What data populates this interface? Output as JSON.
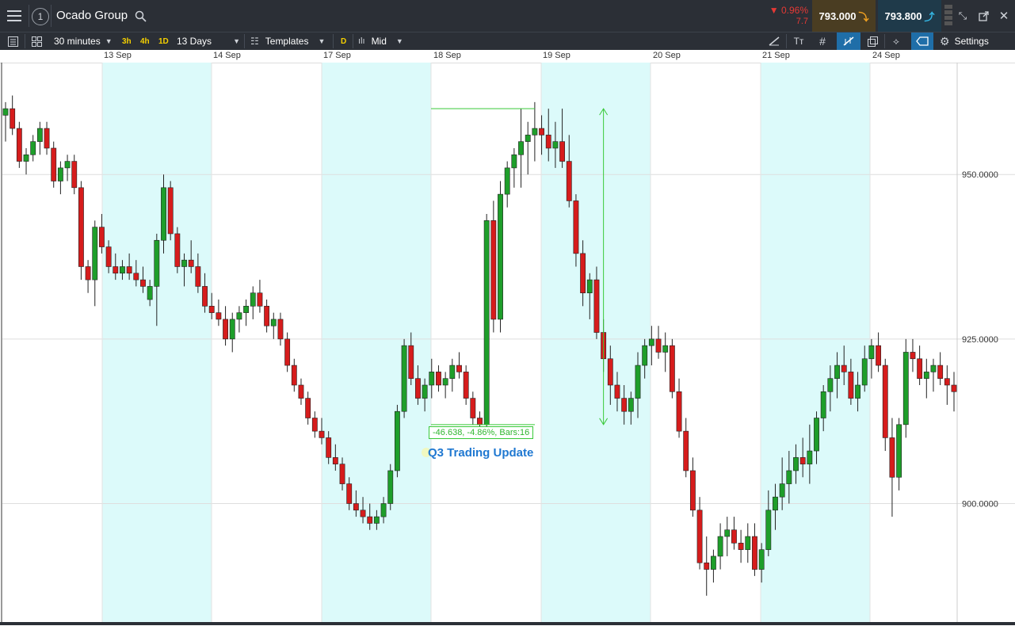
{
  "header": {
    "instrument": "Ocado Group",
    "menu_icon": "hamburger-menu-icon",
    "layout_badge": "1",
    "change_pct": "▼ 0.96%",
    "change_abs": "7.7",
    "sell_price": "793.000",
    "buy_price": "793.800",
    "colors": {
      "sell_bg": "#4a3d22",
      "buy_bg": "#1f3a4a",
      "down": "#e53935"
    }
  },
  "toolbar": {
    "interval": "30 minutes",
    "quick_intervals": [
      "3h",
      "4h",
      "1D"
    ],
    "range": "13 Days",
    "templates": "Templates",
    "price_type_badge": "D",
    "price_type": "Mid",
    "settings": "Settings"
  },
  "date_axis": [
    "13 Sep",
    "14 Sep",
    "17 Sep",
    "18 Sep",
    "19 Sep",
    "20 Sep",
    "21 Sep",
    "24 Sep"
  ],
  "annotation": {
    "measure_label": "-46.638, -4.86%, Bars:16",
    "event_label": "Q3 Trading Update"
  },
  "chart_data": {
    "type": "candlestick",
    "interval": "30 minutes",
    "ylabel_ticks": [
      "950.0000",
      "925.0000",
      "900.0000"
    ],
    "ylim": [
      882,
      967
    ],
    "grid": true,
    "colors": {
      "up": "#1e9e2a",
      "down": "#d61c1c",
      "shade": "#dcfafa",
      "measure": "#39c939"
    },
    "sessions": [
      {
        "label": "13 Sep",
        "shaded": false
      },
      {
        "label": "14 Sep",
        "shaded": true
      },
      {
        "label": "17 Sep",
        "shaded": false
      },
      {
        "label": "18 Sep",
        "shaded": true
      },
      {
        "label": "19 Sep",
        "shaded": false
      },
      {
        "label": "20 Sep",
        "shaded": true
      },
      {
        "label": "21 Sep",
        "shaded": false
      },
      {
        "label": "24 Sep",
        "shaded": true
      },
      {
        "label": "",
        "shaded": false
      }
    ],
    "candles": [
      [
        959,
        961,
        955,
        960
      ],
      [
        960,
        962,
        956,
        957
      ],
      [
        957,
        958,
        951,
        952
      ],
      [
        952,
        954,
        950,
        953
      ],
      [
        953,
        956,
        952,
        955
      ],
      [
        955,
        958,
        953,
        957
      ],
      [
        957,
        958,
        953,
        954
      ],
      [
        954,
        955,
        948,
        949
      ],
      [
        949,
        952,
        947,
        951
      ],
      [
        951,
        953,
        949,
        952
      ],
      [
        952,
        953,
        947,
        948
      ],
      [
        948,
        949,
        934,
        936
      ],
      [
        936,
        937,
        932,
        934
      ],
      [
        934,
        943,
        930,
        942
      ],
      [
        942,
        944,
        938,
        939
      ],
      [
        939,
        940,
        935,
        936
      ],
      [
        936,
        938,
        934,
        935
      ],
      [
        935,
        937,
        934,
        936
      ],
      [
        936,
        938,
        934,
        935
      ],
      [
        935,
        937,
        933,
        934
      ],
      [
        934,
        936,
        932,
        933
      ],
      [
        931,
        934,
        930,
        933
      ],
      [
        933,
        941,
        927,
        940
      ],
      [
        940,
        950,
        938,
        948
      ],
      [
        948,
        949,
        940,
        941
      ],
      [
        941,
        942,
        935,
        936
      ],
      [
        936,
        938,
        933,
        937
      ],
      [
        937,
        940,
        935,
        936
      ],
      [
        936,
        938,
        932,
        933
      ],
      [
        933,
        935,
        929,
        930
      ],
      [
        930,
        932,
        928,
        929
      ],
      [
        929,
        931,
        927,
        928
      ],
      [
        928,
        930,
        924,
        925
      ],
      [
        925,
        929,
        923,
        928
      ],
      [
        928,
        930,
        926,
        929
      ],
      [
        929,
        931,
        927,
        930
      ],
      [
        930,
        933,
        928,
        932
      ],
      [
        932,
        934,
        929,
        930
      ],
      [
        930,
        931,
        926,
        927
      ],
      [
        927,
        929,
        925,
        928
      ],
      [
        928,
        929,
        924,
        925
      ],
      [
        925,
        926,
        920,
        921
      ],
      [
        921,
        922,
        917,
        918
      ],
      [
        918,
        919,
        915,
        916
      ],
      [
        916,
        917,
        912,
        913
      ],
      [
        913,
        914,
        910,
        911
      ],
      [
        911,
        913,
        909,
        910
      ],
      [
        910,
        911,
        906,
        907
      ],
      [
        907,
        909,
        905,
        906
      ],
      [
        906,
        907,
        902,
        903
      ],
      [
        903,
        904,
        899,
        900
      ],
      [
        900,
        902,
        898,
        899
      ],
      [
        899,
        901,
        897,
        898
      ],
      [
        898,
        900,
        896,
        897
      ],
      [
        897,
        899,
        896,
        898
      ],
      [
        898,
        901,
        897,
        900
      ],
      [
        900,
        906,
        899,
        905
      ],
      [
        905,
        915,
        904,
        914
      ],
      [
        914,
        925,
        913,
        924
      ],
      [
        924,
        926,
        918,
        919
      ],
      [
        919,
        921,
        915,
        916
      ],
      [
        916,
        919,
        914,
        918
      ],
      [
        918,
        922,
        916,
        920
      ],
      [
        920,
        921,
        917,
        918
      ],
      [
        918,
        920,
        916,
        919
      ],
      [
        919,
        922,
        917,
        921
      ],
      [
        921,
        923,
        919,
        920
      ],
      [
        920,
        921,
        915,
        916
      ],
      [
        916,
        917,
        912,
        913
      ],
      [
        913,
        914,
        911,
        912
      ],
      [
        912,
        944,
        911,
        943
      ],
      [
        943,
        946,
        926,
        928
      ],
      [
        928,
        949,
        926,
        947
      ],
      [
        947,
        952,
        945,
        951
      ],
      [
        951,
        954,
        948,
        953
      ],
      [
        953,
        960,
        948,
        955
      ],
      [
        955,
        958,
        950,
        956
      ],
      [
        956,
        961,
        952,
        957
      ],
      [
        957,
        959,
        953,
        956
      ],
      [
        956,
        960,
        952,
        954
      ],
      [
        954,
        958,
        951,
        955
      ],
      [
        955,
        960,
        951,
        952
      ],
      [
        952,
        956,
        945,
        946
      ],
      [
        946,
        947,
        936,
        938
      ],
      [
        938,
        940,
        930,
        932
      ],
      [
        932,
        935,
        928,
        934
      ],
      [
        934,
        936,
        925,
        926
      ],
      [
        926,
        928,
        920,
        922
      ],
      [
        922,
        924,
        915,
        918
      ],
      [
        918,
        920,
        914,
        916
      ],
      [
        916,
        918,
        912,
        914
      ],
      [
        914,
        917,
        912,
        916
      ],
      [
        916,
        923,
        913,
        921
      ],
      [
        921,
        925,
        919,
        924
      ],
      [
        924,
        927,
        921,
        925
      ],
      [
        925,
        927,
        922,
        923
      ],
      [
        923,
        926,
        920,
        924
      ],
      [
        924,
        925,
        916,
        917
      ],
      [
        917,
        919,
        910,
        911
      ],
      [
        911,
        913,
        904,
        905
      ],
      [
        905,
        907,
        898,
        899
      ],
      [
        899,
        901,
        890,
        891
      ],
      [
        891,
        895,
        886,
        890
      ],
      [
        890,
        893,
        888,
        892
      ],
      [
        892,
        897,
        890,
        895
      ],
      [
        895,
        898,
        892,
        896
      ],
      [
        896,
        898,
        893,
        894
      ],
      [
        894,
        896,
        891,
        893
      ],
      [
        893,
        897,
        891,
        895
      ],
      [
        895,
        897,
        889,
        890
      ],
      [
        890,
        894,
        888,
        893
      ],
      [
        893,
        902,
        892,
        899
      ],
      [
        899,
        903,
        896,
        901
      ],
      [
        901,
        907,
        899,
        903
      ],
      [
        903,
        908,
        900,
        905
      ],
      [
        905,
        909,
        903,
        907
      ],
      [
        907,
        910,
        904,
        906
      ],
      [
        906,
        912,
        903,
        908
      ],
      [
        908,
        914,
        906,
        913
      ],
      [
        913,
        918,
        911,
        917
      ],
      [
        917,
        921,
        914,
        919
      ],
      [
        919,
        923,
        916,
        921
      ],
      [
        921,
        924,
        918,
        920
      ],
      [
        920,
        922,
        915,
        916
      ],
      [
        916,
        920,
        914,
        918
      ],
      [
        918,
        924,
        917,
        922
      ],
      [
        922,
        925,
        919,
        924
      ],
      [
        924,
        926,
        920,
        921
      ],
      [
        921,
        922,
        908,
        910
      ],
      [
        910,
        913,
        898,
        904
      ],
      [
        904,
        913,
        902,
        912
      ],
      [
        912,
        925,
        910,
        923
      ],
      [
        923,
        925,
        920,
        922
      ],
      [
        922,
        924,
        918,
        919
      ],
      [
        919,
        922,
        916,
        920
      ],
      [
        920,
        922,
        917,
        921
      ],
      [
        921,
        923,
        918,
        919
      ],
      [
        919,
        921,
        915,
        918
      ],
      [
        918,
        920,
        914,
        917
      ]
    ],
    "measure": {
      "from_value": 960,
      "to_value": 912
    }
  }
}
